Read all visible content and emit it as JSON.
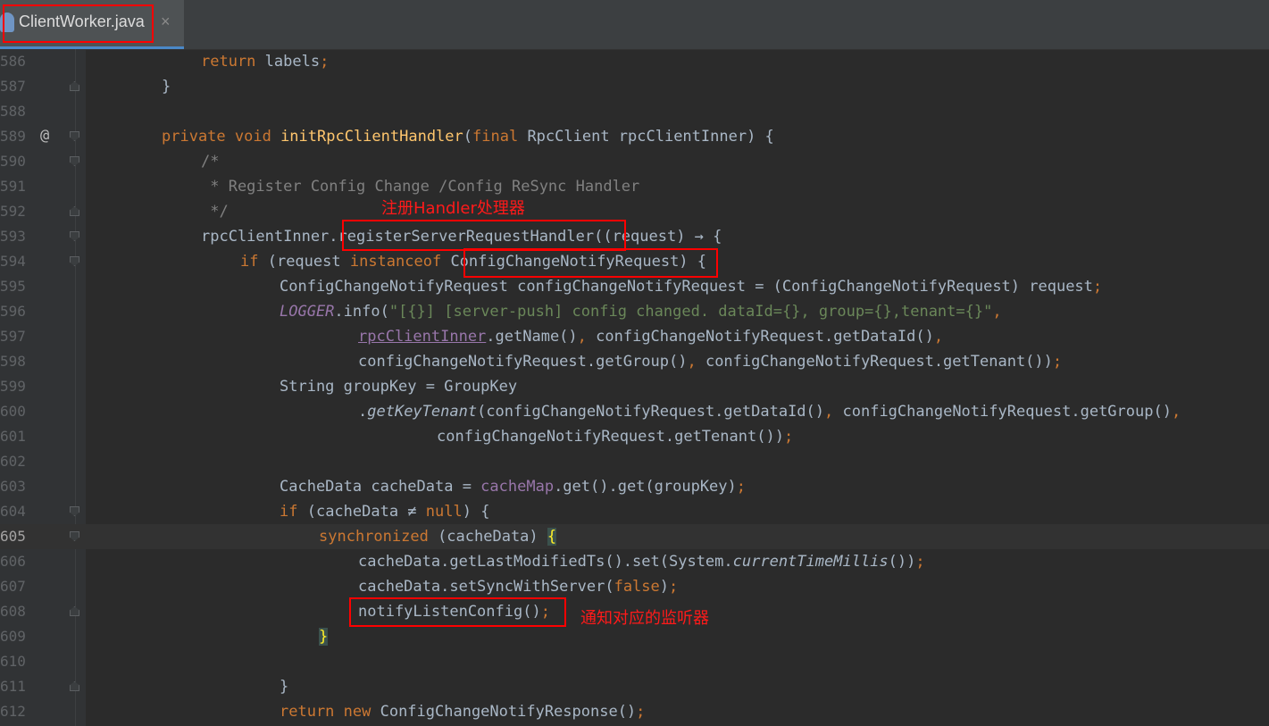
{
  "tab": {
    "filename": "ClientWorker.java",
    "close": "×",
    "icon": "java-class-icon"
  },
  "annotations": {
    "register_note": "注册Handler处理器",
    "notify_note": "通知对应的监听器"
  },
  "lines": [
    {
      "num": "586",
      "segments": [
        [
          "p",
          "return"
        ],
        [
          "t",
          " labels"
        ],
        [
          "p",
          ";"
        ]
      ]
    },
    {
      "num": "587",
      "segments": [
        [
          "t",
          "}"
        ]
      ]
    },
    {
      "num": "588",
      "segments": []
    },
    {
      "num": "589",
      "segments": [
        [
          "p",
          "private void "
        ],
        [
          "f",
          "initRpcClientHandler"
        ],
        [
          "t",
          "("
        ],
        [
          "p",
          "final "
        ],
        [
          "t",
          "RpcClient rpcClientInner) {"
        ]
      ]
    },
    {
      "num": "590",
      "segments": [
        [
          "c",
          "/*"
        ]
      ]
    },
    {
      "num": "591",
      "segments": [
        [
          "c",
          " * Register Config Change /Config ReSync Handler"
        ]
      ]
    },
    {
      "num": "592",
      "segments": [
        [
          "c",
          " */"
        ]
      ]
    },
    {
      "num": "593",
      "segments": [
        [
          "t",
          "rpcClientInner.registerServerRequestHandler((request) → {"
        ]
      ]
    },
    {
      "num": "594",
      "segments": [
        [
          "p",
          "if "
        ],
        [
          "t",
          "(request "
        ],
        [
          "p",
          "instanceof "
        ],
        [
          "t",
          "ConfigChangeNotifyRequest) {"
        ]
      ]
    },
    {
      "num": "595",
      "segments": [
        [
          "t",
          "ConfigChangeNotifyRequest configChangeNotifyRequest = (ConfigChangeNotifyRequest) request"
        ],
        [
          "p",
          ";"
        ]
      ]
    },
    {
      "num": "596",
      "segments": [
        [
          "fi",
          "LOGGER"
        ],
        [
          "t",
          ".info("
        ],
        [
          "s",
          "\"[{}] [server-push] config changed. dataId={}, group={},tenant={}\""
        ],
        [
          "p",
          ","
        ]
      ]
    },
    {
      "num": "597",
      "segments": [
        [
          "u",
          "rpcClientInner"
        ],
        [
          "t",
          ".getName()"
        ],
        [
          "p",
          ", "
        ],
        [
          "t",
          "configChangeNotifyRequest.getDataId()"
        ],
        [
          "p",
          ","
        ]
      ]
    },
    {
      "num": "598",
      "segments": [
        [
          "t",
          "configChangeNotifyRequest.getGroup()"
        ],
        [
          "p",
          ", "
        ],
        [
          "t",
          "configChangeNotifyRequest.getTenant())"
        ],
        [
          "p",
          ";"
        ]
      ]
    },
    {
      "num": "599",
      "segments": [
        [
          "t",
          "String groupKey = GroupKey"
        ]
      ]
    },
    {
      "num": "600",
      "segments": [
        [
          "t",
          "."
        ],
        [
          "i",
          "getKeyTenant"
        ],
        [
          "t",
          "(configChangeNotifyRequest.getDataId()"
        ],
        [
          "p",
          ", "
        ],
        [
          "t",
          "configChangeNotifyRequest.getGroup()"
        ],
        [
          "p",
          ","
        ]
      ]
    },
    {
      "num": "601",
      "segments": [
        [
          "t",
          "configChangeNotifyRequest.getTenant())"
        ],
        [
          "p",
          ";"
        ]
      ]
    },
    {
      "num": "602",
      "segments": []
    },
    {
      "num": "603",
      "segments": [
        [
          "t",
          "CacheData cacheData = "
        ],
        [
          "fl",
          "cacheMap"
        ],
        [
          "t",
          ".get().get(groupKey)"
        ],
        [
          "p",
          ";"
        ]
      ]
    },
    {
      "num": "604",
      "segments": [
        [
          "p",
          "if "
        ],
        [
          "t",
          "(cacheData ≠ "
        ],
        [
          "p",
          "null"
        ],
        [
          "t",
          ") {"
        ]
      ]
    },
    {
      "num": "605",
      "segments": [
        [
          "p",
          "synchronized "
        ],
        [
          "t",
          "(cacheData) "
        ],
        [
          "b",
          "{"
        ]
      ]
    },
    {
      "num": "606",
      "segments": [
        [
          "t",
          "cacheData.getLastModifiedTs().set(System."
        ],
        [
          "i",
          "currentTimeMillis"
        ],
        [
          "t",
          "())"
        ],
        [
          "p",
          ";"
        ]
      ]
    },
    {
      "num": "607",
      "segments": [
        [
          "t",
          "cacheData.setSyncWithServer("
        ],
        [
          "p",
          "false"
        ],
        [
          "t",
          ")"
        ],
        [
          "p",
          ";"
        ]
      ]
    },
    {
      "num": "608",
      "segments": [
        [
          "t",
          "notifyListenConfig()"
        ],
        [
          "p",
          ";"
        ]
      ]
    },
    {
      "num": "609",
      "segments": [
        [
          "b",
          "}"
        ]
      ]
    },
    {
      "num": "610",
      "segments": []
    },
    {
      "num": "611",
      "segments": [
        [
          "t",
          "}"
        ]
      ]
    },
    {
      "num": "612",
      "segments": [
        [
          "p",
          "return new "
        ],
        [
          "t",
          "ConfigChangeNotifyResponse()"
        ],
        [
          "p",
          ";"
        ]
      ]
    }
  ]
}
